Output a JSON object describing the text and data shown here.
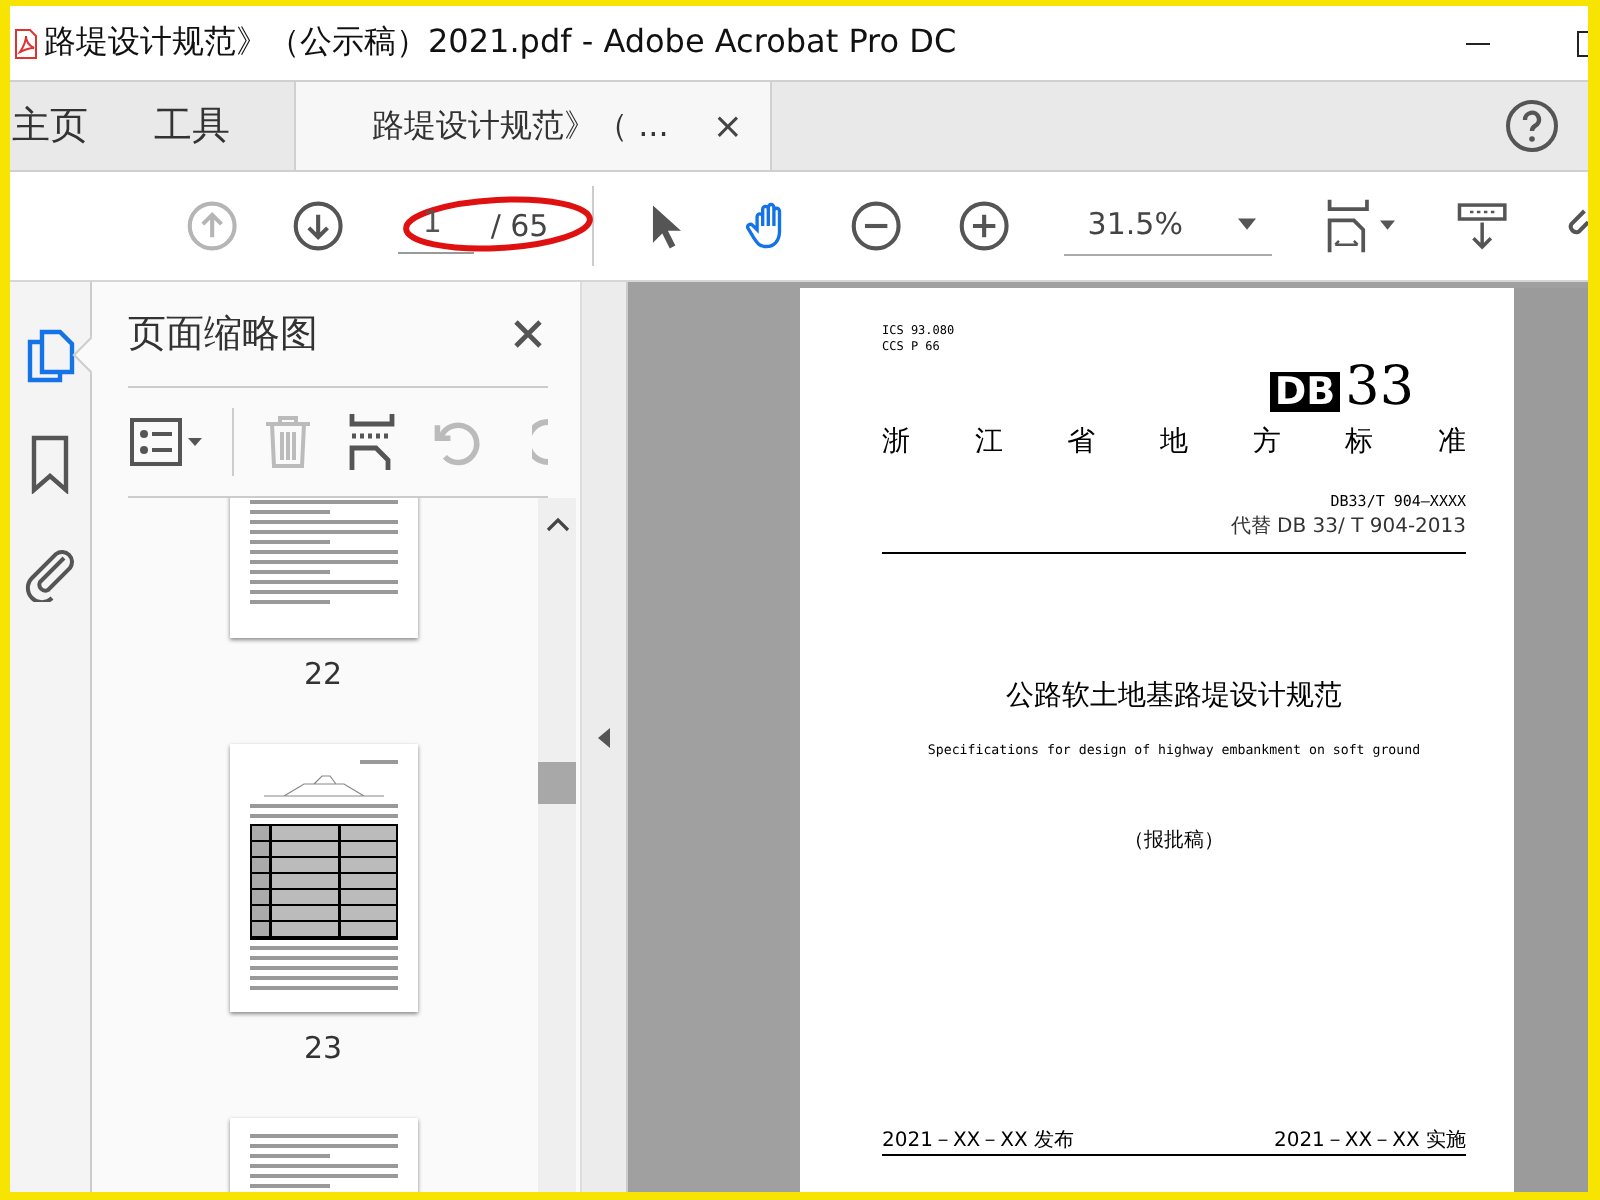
{
  "window": {
    "title": "路堤设计规范》（公示稿）2021.pdf - Adobe Acrobat Pro DC"
  },
  "tabs": [
    {
      "label": "主页",
      "kind": "nav",
      "selected": false
    },
    {
      "label": "工具",
      "kind": "nav",
      "selected": false
    },
    {
      "label": "路堤设计规范》（ ...",
      "kind": "document",
      "selected": true,
      "close": "×"
    }
  ],
  "toolbar": {
    "prev_page": {
      "disabled": true
    },
    "next_page": {
      "disabled": false
    },
    "page_input": {
      "value": "1"
    },
    "page_total": "/ 65",
    "tools": [
      {
        "kind": "select",
        "selected": false
      },
      {
        "kind": "hand",
        "selected": true
      }
    ],
    "zoom": {
      "value": "31.5%"
    }
  },
  "rail": [
    {
      "kind": "thumbnails",
      "selected": true
    },
    {
      "kind": "bookmarks",
      "selected": false
    },
    {
      "kind": "attachments",
      "selected": false
    }
  ],
  "panel": {
    "title": "页面缩略图",
    "toolbar": [
      {
        "kind": "options",
        "disabled": false
      },
      {
        "kind": "delete",
        "disabled": true
      },
      {
        "kind": "insert",
        "disabled": false
      },
      {
        "kind": "rotate-left",
        "disabled": true
      }
    ],
    "thumbnails": [
      {
        "kind": "text",
        "label": "22"
      },
      {
        "kind": "table",
        "label": "23"
      },
      {
        "kind": "text"
      }
    ]
  },
  "document": {
    "ics": "ICS 93.080",
    "ccs": "CCS P 66",
    "logo_letters": "DB",
    "logo_number": "33",
    "standard_type": [
      "浙",
      "江",
      "省",
      "地",
      "方",
      "标",
      "准"
    ],
    "code": "DB33/T 904—XXXX",
    "replaces": "代替 DB 33/ T 904-2013",
    "title": "公路软土地基路堤设计规范",
    "subtitle": "Specifications for design of highway embankment on soft ground",
    "status": "（报批稿）",
    "release": "2021－XX－XX 发布",
    "implement": "2021－XX－XX 实施"
  }
}
